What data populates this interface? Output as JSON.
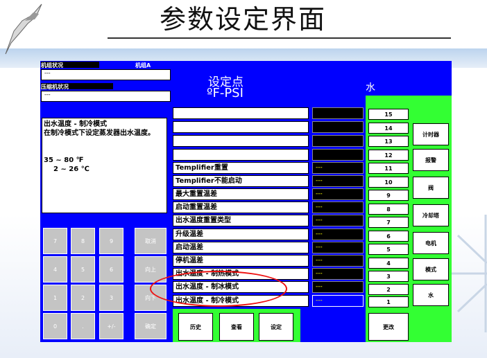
{
  "slide": {
    "title": "参数设定界面"
  },
  "status": {
    "unit_status_label": "机组状况",
    "unit_name": "机组A",
    "unit_status_value": "---",
    "compressor_status_label": "压缩机状况",
    "compressor_status_value": "---"
  },
  "header": {
    "line1": "设定点",
    "line2": "ºF-PSI",
    "water": "水"
  },
  "description": {
    "title": "出水温度 - 制冷模式",
    "body": "在制冷模式下设定蒸发器出水温度。",
    "range_f": "35 ~ 80 ℉",
    "range_c": "2 ~ 26 ℃"
  },
  "keypad": [
    [
      "7",
      "8",
      "9",
      "取消"
    ],
    [
      "4",
      "5",
      "6",
      "向上"
    ],
    [
      "1",
      "2",
      "3",
      "向下"
    ],
    [
      "0",
      ".",
      "+/-",
      "确定"
    ]
  ],
  "params": [
    {
      "label": "",
      "value": ""
    },
    {
      "label": "",
      "value": ""
    },
    {
      "label": "",
      "value": ""
    },
    {
      "label": "",
      "value": ""
    },
    {
      "label": "Templifier重置",
      "value": "---"
    },
    {
      "label": "Templifier不能启动",
      "value": "---"
    },
    {
      "label": "最大重置温差",
      "value": "---"
    },
    {
      "label": "启动重置温差",
      "value": "---"
    },
    {
      "label": "出水温度重置类型",
      "value": "---"
    },
    {
      "label": "升级温差",
      "value": "---"
    },
    {
      "label": "启动温差",
      "value": "---"
    },
    {
      "label": "停机温差",
      "value": "---"
    },
    {
      "label": "出水温度 - 制热模式",
      "value": "---"
    },
    {
      "label": "出水温度 - 制冰模式",
      "value": "---"
    },
    {
      "label": "出水温度 - 制冷模式",
      "value": "---"
    }
  ],
  "bottom_buttons": {
    "history": "历史",
    "view": "查看",
    "set": "设定",
    "change": "更改"
  },
  "page_buttons": [
    "15",
    "14",
    "13",
    "12",
    "11",
    "10",
    "9",
    "8",
    "7",
    "6",
    "5",
    "4",
    "3",
    "2",
    "1"
  ],
  "side_buttons": [
    "计时器",
    "报警",
    "阀",
    "冷却塔",
    "电机",
    "模式",
    "水"
  ]
}
